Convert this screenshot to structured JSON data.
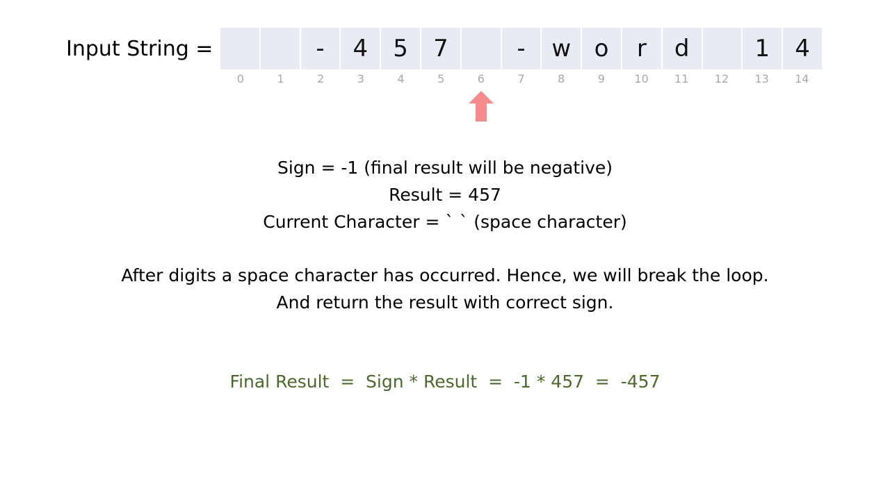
{
  "input": {
    "label": "Input String =",
    "characters": [
      " ",
      " ",
      "-",
      "4",
      "5",
      "7",
      " ",
      "-",
      "w",
      "o",
      "r",
      "d",
      " ",
      "1",
      "4"
    ],
    "indices": [
      "0",
      "1",
      "2",
      "3",
      "4",
      "5",
      "6",
      "7",
      "8",
      "9",
      "10",
      "11",
      "12",
      "13",
      "14"
    ],
    "pointer_index": 6,
    "pointer_color": "#f68b8b",
    "cell_color": "#e8ebf4"
  },
  "state": {
    "sign_line": "Sign = -1  (final result will be negative)",
    "result_line": "Result = 457",
    "current_char_line": "Current Character = `  ` (space character)"
  },
  "explanation": {
    "line1": "After digits a space character has occurred. Hence, we will break the loop.",
    "line2": "And return the result with correct sign."
  },
  "final": {
    "text": "Final Result  =  Sign * Result  =  -1 * 457  =  -457",
    "color": "#4a6a2c"
  }
}
